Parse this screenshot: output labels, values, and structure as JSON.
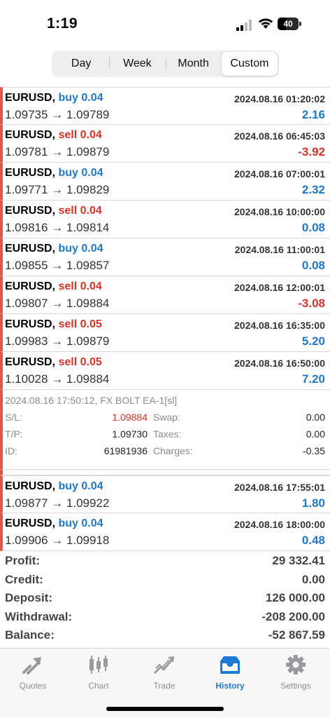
{
  "status": {
    "time": "1:19",
    "battery": "40",
    "battery_level": 0.4
  },
  "segments": [
    {
      "label": "Day",
      "active": false
    },
    {
      "label": "Week",
      "active": false
    },
    {
      "label": "Month",
      "active": false
    },
    {
      "label": "Custom",
      "active": true
    }
  ],
  "deals": [
    {
      "symbol": "EURUSD,",
      "type": "buy 0.04",
      "time": "2024.08.16 01:20:02",
      "open": "1.09735",
      "arrow": "→",
      "close": "1.09789",
      "profit": "2.16"
    },
    {
      "symbol": "EURUSD,",
      "type": "sell 0.04",
      "time": "2024.08.16 06:45:03",
      "open": "1.09781",
      "arrow": "→",
      "close": "1.09879",
      "profit": "-3.92"
    },
    {
      "symbol": "EURUSD,",
      "type": "buy 0.04",
      "time": "2024.08.16 07:00:01",
      "open": "1.09771",
      "arrow": "→",
      "close": "1.09829",
      "profit": "2.32"
    },
    {
      "symbol": "EURUSD,",
      "type": "sell 0.04",
      "time": "2024.08.16 10:00:00",
      "open": "1.09816",
      "arrow": "→",
      "close": "1.09814",
      "profit": "0.08"
    },
    {
      "symbol": "EURUSD,",
      "type": "buy 0.04",
      "time": "2024.08.16 11:00:01",
      "open": "1.09855",
      "arrow": "→",
      "close": "1.09857",
      "profit": "0.08"
    },
    {
      "symbol": "EURUSD,",
      "type": "sell 0.04",
      "time": "2024.08.16 12:00:01",
      "open": "1.09807",
      "arrow": "→",
      "close": "1.09884",
      "profit": "-3.08"
    },
    {
      "symbol": "EURUSD,",
      "type": "sell 0.05",
      "time": "2024.08.16 16:35:00",
      "open": "1.09983",
      "arrow": "→",
      "close": "1.09879",
      "profit": "5.20"
    },
    {
      "symbol": "EURUSD,",
      "type": "sell 0.05",
      "time": "2024.08.16 16:50:00",
      "open": "1.10028",
      "arrow": "→",
      "close": "1.09884",
      "profit": "7.20"
    }
  ],
  "details": {
    "header": "2024.08.16 17:50:12, FX BOLT EA-1[sl]",
    "sl_label": "S/L:",
    "sl_value": "1.09884",
    "tp_label": "T/P:",
    "tp_value": "1.09730",
    "id_label": "ID:",
    "id_value": "61981936",
    "swap_label": "Swap:",
    "swap_value": "0.00",
    "taxes_label": "Taxes:",
    "taxes_value": "0.00",
    "charges_label": "Charges:",
    "charges_value": "-0.35"
  },
  "deals_after": [
    {
      "symbol": "EURUSD,",
      "type": "buy 0.04",
      "time": "2024.08.16 17:55:01",
      "open": "1.09877",
      "arrow": "→",
      "close": "1.09922",
      "profit": "1.80"
    },
    {
      "symbol": "EURUSD,",
      "type": "buy 0.04",
      "time": "2024.08.16 18:00:00",
      "open": "1.09906",
      "arrow": "→",
      "close": "1.09918",
      "profit": "0.48"
    }
  ],
  "summary": {
    "profit_label": "Profit:",
    "profit_value": "29 332.41",
    "credit_label": "Credit:",
    "credit_value": "0.00",
    "deposit_label": "Deposit:",
    "deposit_value": "126 000.00",
    "withdrawal_label": "Withdrawal:",
    "withdrawal_value": "-208 200.00",
    "balance_label": "Balance:",
    "balance_value": "-52 867.59"
  },
  "tabs": [
    {
      "label": "Quotes",
      "icon": "quotes-icon",
      "active": false
    },
    {
      "label": "Chart",
      "icon": "chart-icon",
      "active": false
    },
    {
      "label": "Trade",
      "icon": "trade-icon",
      "active": false
    },
    {
      "label": "History",
      "icon": "history-icon",
      "active": true
    },
    {
      "label": "Settings",
      "icon": "settings-icon",
      "active": false
    }
  ],
  "colors": {
    "buy": "#2079c9",
    "sell": "#d9322a",
    "accent": "#1f7ad6",
    "marker": "#e0574b"
  }
}
